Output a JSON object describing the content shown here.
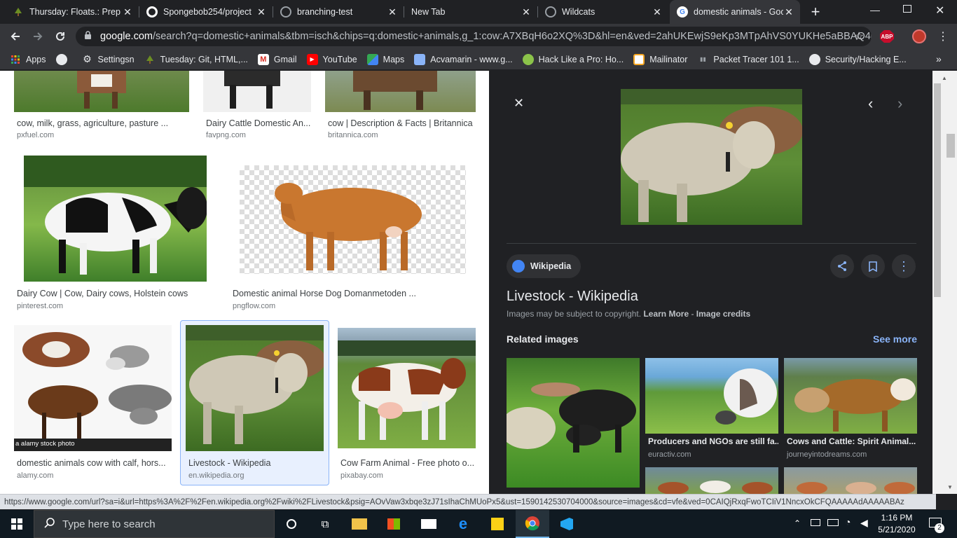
{
  "tabs": [
    {
      "label": "Thursday: Floats.: Prep !",
      "icon": "tree-icon",
      "color": "#6b8e23"
    },
    {
      "label": "Spongebob254/project",
      "icon": "github-icon",
      "color": "#ffffff"
    },
    {
      "label": "branching-test",
      "icon": "globe-icon",
      "color": "#9aa0a6"
    },
    {
      "label": "New Tab",
      "icon": "",
      "color": ""
    },
    {
      "label": "Wildcats",
      "icon": "globe-icon",
      "color": "#9aa0a6"
    },
    {
      "label": "domestic animals - Goo",
      "icon": "google-icon",
      "color": "#ffffff"
    }
  ],
  "toolbar": {
    "url_host": "google.com",
    "url_path": "/search?q=domestic+animals&tbm=isch&chips=q:domestic+animals,g_1:cow:A7XBqH6o2XQ%3D&hl=en&ved=2ahUKEwjS9eKp3MTpAhVS0YUKHe5aBBAQ4l...",
    "abp_label": "ABP"
  },
  "bookmarks": [
    {
      "label": "Apps",
      "icon": "apps-grid-icon"
    },
    {
      "label": "",
      "icon": "globe-icon"
    },
    {
      "label": "Settingsn",
      "icon": "gear-icon"
    },
    {
      "label": "Tuesday: Git, HTML,...",
      "icon": "tree-icon"
    },
    {
      "label": "Gmail",
      "icon": "gmail-icon"
    },
    {
      "label": "YouTube",
      "icon": "youtube-icon"
    },
    {
      "label": "Maps",
      "icon": "maps-icon"
    },
    {
      "label": "Acvamarin - www.g...",
      "icon": "doc-icon"
    },
    {
      "label": "Hack Like a Pro: Ho...",
      "icon": "shield-icon"
    },
    {
      "label": "Mailinator",
      "icon": "mail-icon"
    },
    {
      "label": "Packet Tracer 101 1...",
      "icon": "cisco-icon"
    },
    {
      "label": "Security/Hacking E...",
      "icon": "globe-icon"
    }
  ],
  "results": [
    {
      "title": "cow, milk, grass, agriculture, pasture ...",
      "source": "pxfuel.com"
    },
    {
      "title": "Dairy Cattle Domestic An...",
      "source": "favpng.com"
    },
    {
      "title": "cow | Description & Facts | Britannica",
      "source": "britannica.com"
    },
    {
      "title": "Dairy Cow | Cow, Dairy cows, Holstein cows",
      "source": "pinterest.com"
    },
    {
      "title": "Domestic animal Horse Dog Domanmetoden ...",
      "source": "pngflow.com"
    },
    {
      "title": "domestic animals cow with calf, hors...",
      "source": "alamy.com",
      "watermark": "a alamy stock photo"
    },
    {
      "title": "Livestock - Wikipedia",
      "source": "en.wikipedia.org"
    },
    {
      "title": "Cow Farm Animal - Free photo o...",
      "source": "pixabay.com"
    }
  ],
  "panel": {
    "source_chip": "Wikipedia",
    "title": "Livestock - Wikipedia",
    "copyright_text": "Images may be subject to copyright.",
    "learn_more": "Learn More",
    "separator": " - ",
    "image_credits": "Image credits",
    "related_heading": "Related images",
    "see_more": "See more",
    "related": [
      {
        "title": "",
        "source": ""
      },
      {
        "title": "Producers and NGOs are still fa...",
        "source": "euractiv.com"
      },
      {
        "title": "Cows and Cattle: Spirit Animal...",
        "source": "journeyintodreams.com"
      }
    ]
  },
  "status_url": "https://www.google.com/url?sa=i&url=https%3A%2F%2Fen.wikipedia.org%2Fwiki%2FLivestock&psig=AOvVaw3xbqe3zJ71sIhaChMUoPx5&ust=1590142530704000&source=images&cd=vfe&ved=0CAIQjRxqFwoTCIiV1NncxOkCFQAAAAAdAAAAABAz",
  "taskbar": {
    "search_placeholder": "Type here to search",
    "time": "1:16 PM",
    "date": "5/21/2020",
    "notification_count": "2"
  }
}
